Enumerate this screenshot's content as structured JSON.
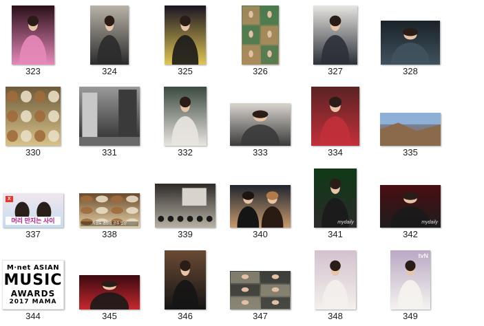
{
  "thumbnails": [
    {
      "number": "323",
      "art": "portrait",
      "colors": [
        "#2a0f19",
        "#e789b9"
      ]
    },
    {
      "number": "324",
      "art": "portrait",
      "colors": [
        "#b9b3a8",
        "#2b2b2b"
      ]
    },
    {
      "number": "325",
      "art": "stage",
      "colors": [
        "#1a1523",
        "#e0c653"
      ]
    },
    {
      "number": "326",
      "art": "tv-grid",
      "colors": [
        "#4b7a4f",
        "#aa8b5c"
      ]
    },
    {
      "number": "327",
      "art": "portrait",
      "colors": [
        "#e7e5e0",
        "#2c3038"
      ]
    },
    {
      "number": "328",
      "art": "portrait",
      "colors": [
        "#1a2228",
        "#40525e"
      ]
    },
    {
      "number": "330",
      "art": "food",
      "colors": [
        "#6d5a3a",
        "#d8c28a"
      ]
    },
    {
      "number": "331",
      "art": "street",
      "colors": [
        "#9a9a9a",
        "#2a2a2a"
      ]
    },
    {
      "number": "332",
      "art": "portrait",
      "colors": [
        "#3b4a3f",
        "#e9e6e0"
      ]
    },
    {
      "number": "333",
      "art": "portrait",
      "colors": [
        "#d9d5cf",
        "#3a3a3a"
      ]
    },
    {
      "number": "334",
      "art": "portrait",
      "colors": [
        "#5a2324",
        "#c2303a"
      ]
    },
    {
      "number": "335",
      "art": "landscape",
      "colors": [
        "#6e8fbf",
        "#8a6a4a"
      ]
    },
    {
      "number": "337",
      "art": "tv-variety",
      "colors": [
        "#f0e6ee",
        "#c6dcef"
      ],
      "tag": "X",
      "banner": "머리 만지는 사이"
    },
    {
      "number": "338",
      "art": "food-table",
      "colors": [
        "#6a4a2c",
        "#e4d2a8"
      ],
      "caption": "지금도 괜찮은 궁중 밥상"
    },
    {
      "number": "339",
      "art": "room",
      "colors": [
        "#2e2a28",
        "#b8b2a4"
      ]
    },
    {
      "number": "340",
      "art": "duo",
      "colors": [
        "#20252d",
        "#c79a6e"
      ]
    },
    {
      "number": "341",
      "art": "stage",
      "colors": [
        "#0f3a16",
        "#2a2a2a"
      ],
      "watermark": "mydaily"
    },
    {
      "number": "342",
      "art": "stage",
      "colors": [
        "#4a0e12",
        "#1d1d1d"
      ],
      "watermark": "mydaily"
    },
    {
      "number": "344",
      "art": "logo",
      "logo_lines": [
        "M·net ASIAN",
        "MUSIC",
        "AWARDS",
        "2017 MAMA"
      ]
    },
    {
      "number": "345",
      "art": "stage-dark",
      "colors": [
        "#3a0a10",
        "#c6282f"
      ]
    },
    {
      "number": "346",
      "art": "portrait",
      "colors": [
        "#6a4a34",
        "#151515"
      ]
    },
    {
      "number": "347",
      "art": "collage",
      "colors": [
        "#3d3e3a",
        "#8a8675"
      ]
    },
    {
      "number": "348",
      "art": "portrait",
      "colors": [
        "#d3c2cf",
        "#f3f0ec"
      ]
    },
    {
      "number": "349",
      "art": "portrait",
      "colors": [
        "#b9a9c4",
        "#f5f3f0"
      ],
      "badge": "tvN"
    }
  ]
}
